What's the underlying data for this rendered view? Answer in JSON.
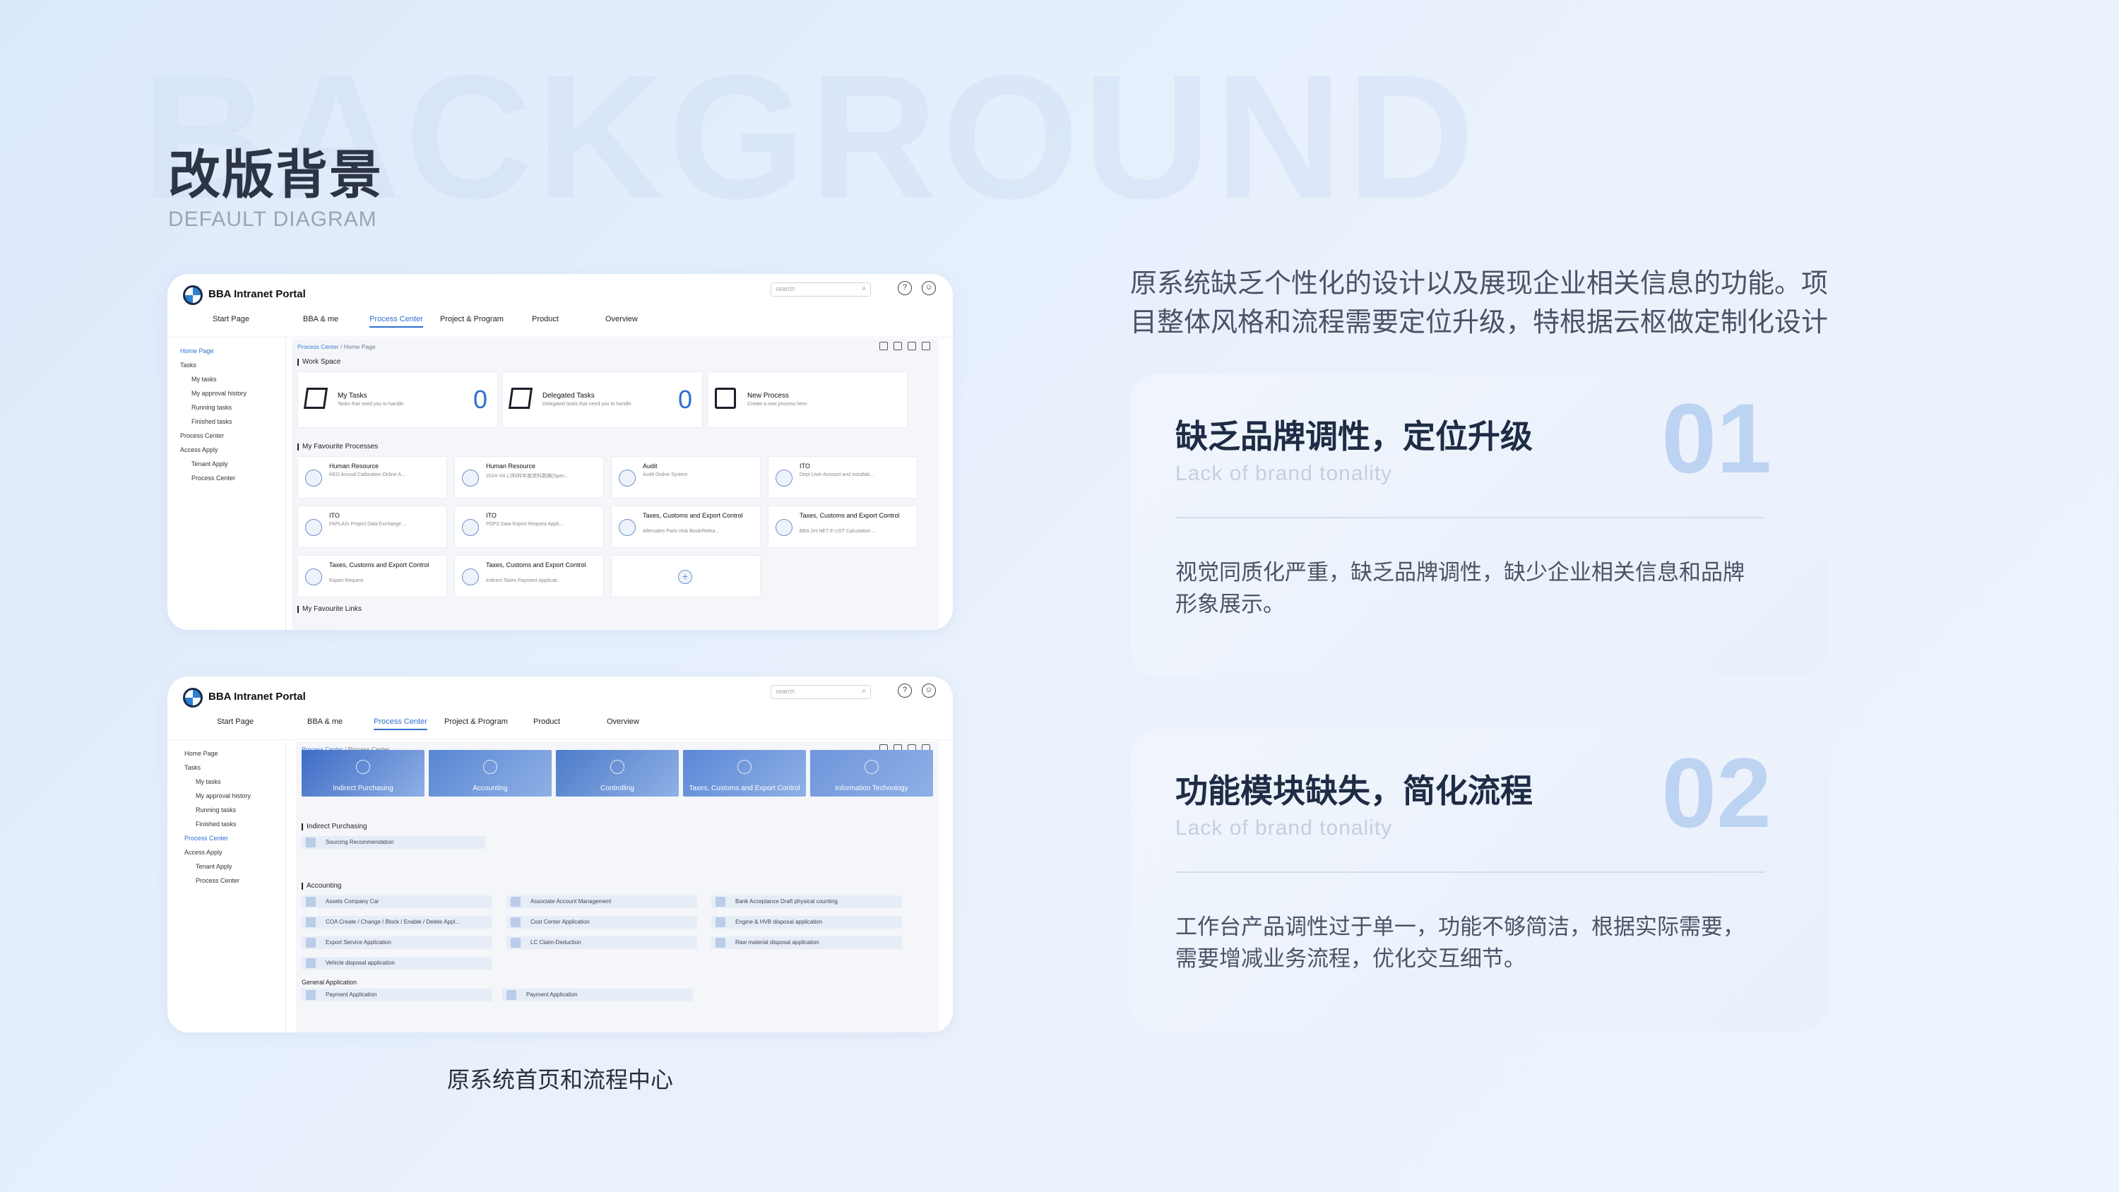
{
  "background_word": "BACKGROUND",
  "title": "改版背景",
  "subtitle": "DEFAULT DIAGRAM",
  "caption": "原系统首页和流程中心",
  "intro": "原系统缺乏个性化的设计以及展现企业相关信息的功能。项目整体风格和流程需要定位升级，特根据云枢做定制化设计",
  "panels": [
    {
      "heading": "缺乏品牌调性，定位升级",
      "english": "Lack of brand tonality",
      "number": "01",
      "body": "视觉同质化严重，缺乏品牌调性，缺少企业相关信息和品牌形象展示。"
    },
    {
      "heading": "功能模块缺失，简化流程",
      "english": "Lack of brand tonality",
      "number": "02",
      "body": "工作台产品调性过于单一，功能不够简洁，根据实际需要，需要增减业务流程，优化交互细节。"
    }
  ],
  "portal": {
    "title": "BBA Intranet Portal",
    "search_placeholder": "search",
    "help_icon": "?",
    "user_icon": "user-icon",
    "nav": [
      "Start Page",
      "BBA & me",
      "Process Center",
      "Project & Program",
      "Product",
      "Overview"
    ],
    "sidebar1": [
      "Home Page",
      "Tasks",
      "My tasks",
      "My approval history",
      "Running tasks",
      "Finished tasks",
      "Process Center",
      "Access Apply",
      "Tenant Apply",
      "Process Center"
    ],
    "sidebar2": [
      "Home Page",
      "Tasks",
      "My tasks",
      "My approval history",
      "Running tasks",
      "Finished tasks",
      "Process Center",
      "Access Apply",
      "Tenant Apply",
      "Process Center"
    ],
    "crumb1": [
      "Process Center",
      "/",
      "Home Page"
    ],
    "crumb2": [
      "Process Center",
      "/",
      "Process Center"
    ],
    "work_space": "Work Space",
    "tasks": [
      {
        "title": "My Tasks",
        "desc": "Tasks that need you to handle.",
        "count": "0"
      },
      {
        "title": "Delegated Tasks",
        "desc": "Delegated tasks that need you to handle.",
        "count": "0"
      },
      {
        "title": "New Process",
        "desc": "Create a new process here.",
        "count": ""
      }
    ],
    "fav_processes": "My Favourite Processes",
    "favs": [
      {
        "t": "Human Resource",
        "s": "KEO Annual Calibration Online A..."
      },
      {
        "t": "Human Resource",
        "s": "2024~04 L2料料年度资料数据(Spec..."
      },
      {
        "t": "Audit",
        "s": "Audit Online System"
      },
      {
        "t": "ITO",
        "s": "Dept User Account and installati..."
      },
      {
        "t": "ITO",
        "s": "FAPLASI Project Data Exchange ..."
      },
      {
        "t": "ITO",
        "s": "PDPS Data Export Request Appli..."
      },
      {
        "t": "Taxes, Customs and Export Control",
        "s": "Aftersales Parts Hub Book/Relea..."
      },
      {
        "t": "Taxes, Customs and Export Control",
        "s": "BBA SH NET E-UST Calculation ..."
      },
      {
        "t": "Taxes, Customs and Export Control",
        "s": "Export Request"
      },
      {
        "t": "Taxes, Customs and Export Control",
        "s": "Indirect Taxes Payment Applicati..."
      }
    ],
    "fav_links": "My Favourite Links",
    "banners": [
      "Indirect Purchasing",
      "Accounting",
      "Controlling",
      "Taxes, Customs and Export Control",
      "Information Technology"
    ],
    "sec_indirect": "Indirect Purchasing",
    "indirect_items": [
      "Sourcing Recommendation"
    ],
    "sec_accounting": "Accounting",
    "accounting_items": [
      "Assets Company Car",
      "Associate Account Management",
      "Bank Acceptance Draft physical counting",
      "COA Create / Change / Block / Enable / Delete Appl...",
      "Cost Center Application",
      "Engine & HVB disposal application",
      "Export Service Application",
      "LC Claim-Deduction",
      "Raw material disposal application",
      "Vehicle disposal application"
    ],
    "sec_general": "General Application",
    "general_items": [
      "Payment Application",
      "Payment Application"
    ]
  }
}
